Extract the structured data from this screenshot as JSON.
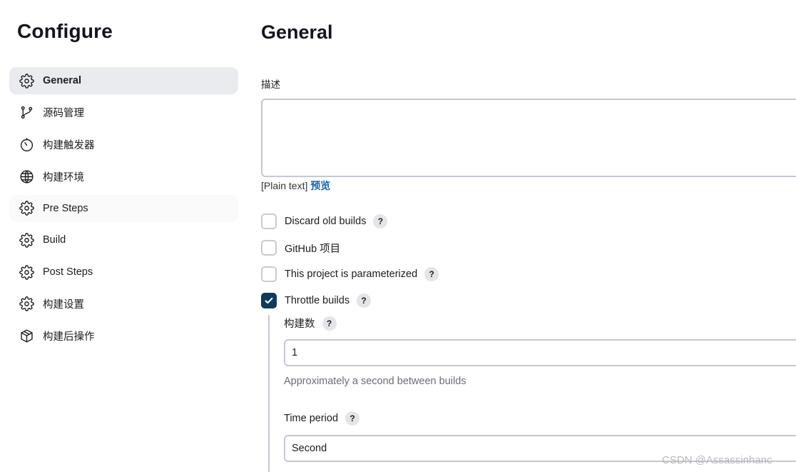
{
  "sidebar": {
    "title": "Configure",
    "items": [
      {
        "label": "General",
        "icon": "gear-icon"
      },
      {
        "label": "源码管理",
        "icon": "git-branch-icon"
      },
      {
        "label": "构建触发器",
        "icon": "timer-icon"
      },
      {
        "label": "构建环境",
        "icon": "globe-icon"
      },
      {
        "label": "Pre Steps",
        "icon": "gear-icon"
      },
      {
        "label": "Build",
        "icon": "gear-icon"
      },
      {
        "label": "Post Steps",
        "icon": "gear-icon"
      },
      {
        "label": "构建设置",
        "icon": "gear-icon"
      },
      {
        "label": "构建后操作",
        "icon": "package-icon"
      }
    ],
    "active_item": "General"
  },
  "main": {
    "title": "General",
    "description": {
      "label": "描述",
      "value": "",
      "plain_text": "[Plain text]",
      "preview": "预览"
    },
    "options": [
      {
        "label": "Discard old builds",
        "checked": false,
        "help": "?"
      },
      {
        "label": "GitHub 项目",
        "checked": false
      },
      {
        "label": "This project is parameterized",
        "checked": false,
        "help": "?"
      },
      {
        "label": "Throttle builds",
        "checked": true,
        "help": "?"
      }
    ],
    "throttle": {
      "count_label": "构建数",
      "count_help": "?",
      "count_value": "1",
      "hint": "Approximately a second between builds",
      "period_label": "Time period",
      "period_help": "?",
      "period_value": "Second"
    }
  },
  "watermark": "CSDN @Assassinhanc",
  "colors": {
    "accent": "#0e3a5e",
    "link": "#1567b8",
    "active_nav_bg": "#eaebef",
    "border": "#c3c8d0"
  }
}
